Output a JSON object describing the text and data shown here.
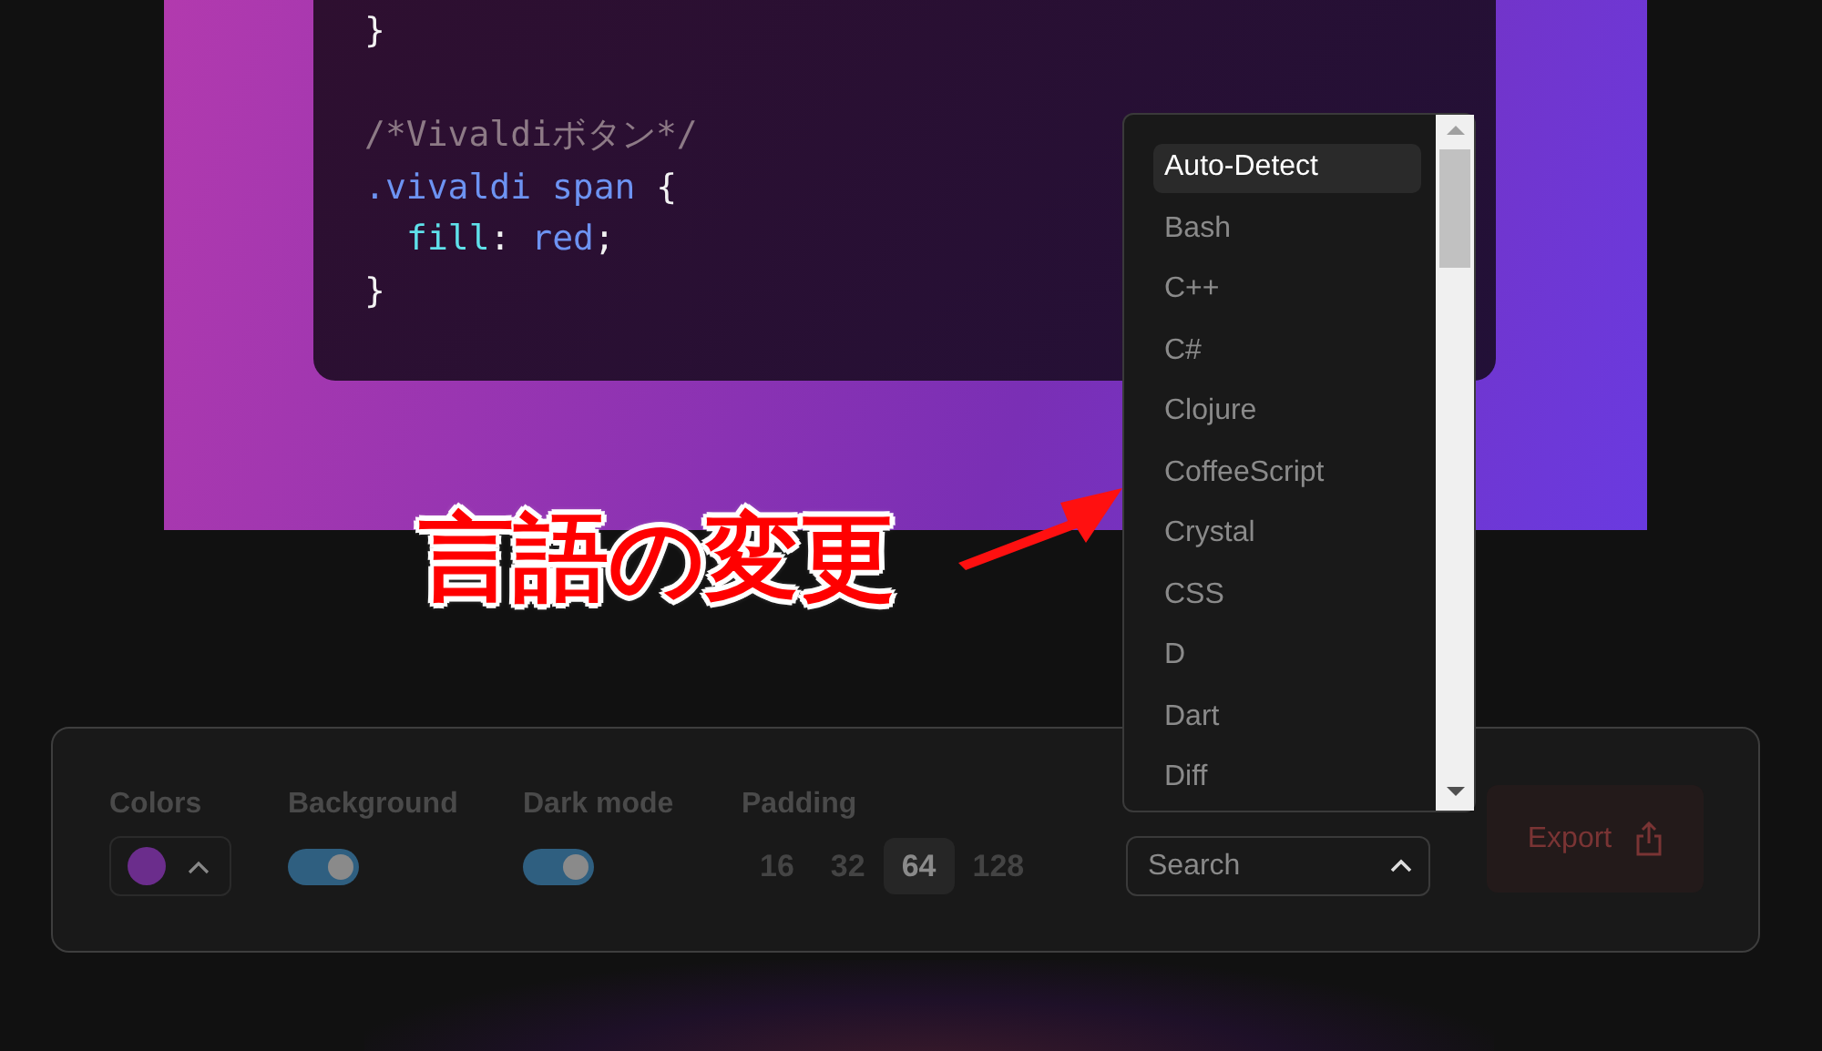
{
  "code_lines": [
    {
      "kind": "code",
      "indented": false,
      "tokens": [
        {
          "kind": "punct",
          "text": "}"
        }
      ]
    },
    {
      "kind": "blank"
    },
    {
      "kind": "code",
      "indented": false,
      "tokens": [
        {
          "kind": "comment",
          "text": "/*Vivaldiボタン*/"
        }
      ]
    },
    {
      "kind": "code",
      "indented": false,
      "tokens": [
        {
          "kind": "selector",
          "text": ".vivaldi span"
        },
        {
          "kind": "punct",
          "text": " {"
        }
      ]
    },
    {
      "kind": "code",
      "indented": true,
      "tokens": [
        {
          "kind": "property",
          "text": "fill"
        },
        {
          "kind": "punct",
          "text": ": "
        },
        {
          "kind": "value",
          "text": "red"
        },
        {
          "kind": "punct",
          "text": ";"
        }
      ]
    },
    {
      "kind": "code",
      "indented": false,
      "tokens": [
        {
          "kind": "punct",
          "text": "}"
        }
      ]
    }
  ],
  "controls": {
    "colors": {
      "label": "Colors",
      "color": "#6b2d8c"
    },
    "background": {
      "label": "Background",
      "on": true
    },
    "dark_mode": {
      "label": "Dark mode",
      "on": true
    },
    "padding": {
      "label": "Padding",
      "options": [
        {
          "label": "16",
          "selected": false
        },
        {
          "label": "32",
          "selected": false
        },
        {
          "label": "64",
          "selected": true
        },
        {
          "label": "128",
          "selected": false
        }
      ]
    },
    "language": {
      "placeholder": "Search",
      "options": [
        {
          "label": "Auto-Detect",
          "selected": true
        },
        {
          "label": "Bash",
          "selected": false
        },
        {
          "label": "C++",
          "selected": false
        },
        {
          "label": "C#",
          "selected": false
        },
        {
          "label": "Clojure",
          "selected": false
        },
        {
          "label": "CoffeeScript",
          "selected": false
        },
        {
          "label": "Crystal",
          "selected": false
        },
        {
          "label": "CSS",
          "selected": false
        },
        {
          "label": "D",
          "selected": false
        },
        {
          "label": "Dart",
          "selected": false
        },
        {
          "label": "Diff",
          "selected": false
        }
      ]
    },
    "export": {
      "label": "Export"
    }
  },
  "annotation": {
    "text": "言語の変更"
  }
}
